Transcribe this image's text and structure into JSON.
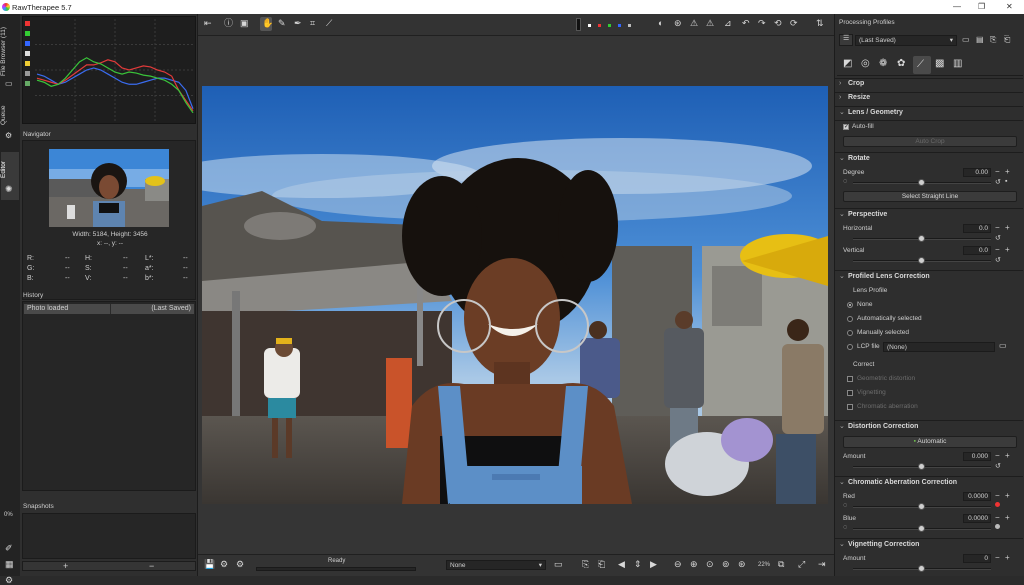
{
  "app": {
    "title": "RawTherapee 5.7"
  },
  "window_controls": {
    "minimize": "—",
    "maximize": "❐",
    "close": "✕"
  },
  "vtabs": {
    "file_browser": "File Browser (11)",
    "queue": "Queue",
    "editor": "Editor"
  },
  "navigator": {
    "header": "Navigator",
    "size_text": "Width: 5184, Height: 3456",
    "coords": "x: --, y: --",
    "readouts": [
      {
        "l1": "R:",
        "v1": "--",
        "l2": "H:",
        "v2": "--",
        "l3": "L*:",
        "v3": "--"
      },
      {
        "l1": "G:",
        "v1": "--",
        "l2": "S:",
        "v2": "--",
        "l3": "a*:",
        "v3": "--"
      },
      {
        "l1": "B:",
        "v1": "--",
        "l2": "V:",
        "v2": "--",
        "l3": "b*:",
        "v3": "--"
      }
    ]
  },
  "history": {
    "header": "History",
    "entry_name": "Photo loaded",
    "entry_value": "(Last Saved)"
  },
  "snapshots": {
    "header": "Snapshots",
    "add": "+",
    "remove": "−"
  },
  "left_strip": {
    "zoom_pct": "0%"
  },
  "status": {
    "ready": "Ready",
    "zoom": "22%",
    "profile_combo": "None"
  },
  "right": {
    "header": "Processing Profiles",
    "profile": "(Last Saved)",
    "sections": {
      "crop": "Crop",
      "resize": "Resize",
      "lens": "Lens / Geometry",
      "rotate": "Rotate",
      "perspective": "Perspective",
      "profiled": "Profiled Lens Correction",
      "distortion": "Distortion Correction",
      "ca": "Chromatic Aberration Correction",
      "vignetting": "Vignetting Correction"
    },
    "auto_fill": "Auto-fill",
    "auto_crop": "Auto Crop",
    "degree": {
      "label": "Degree",
      "value": "0.00"
    },
    "select_line": "Select Straight Line",
    "horizontal": {
      "label": "Horizontal",
      "value": "0.0"
    },
    "vertical": {
      "label": "Vertical",
      "value": "0.0"
    },
    "lens_profile": "Lens Profile",
    "lp_options": [
      "None",
      "Automatically selected",
      "Manually selected",
      "LCP file"
    ],
    "lcp_value": "(None)",
    "correct": "Correct",
    "correct_opts": [
      "Geometric distortion",
      "Vignetting",
      "Chromatic aberration"
    ],
    "automatic": "Automatic",
    "amount1": {
      "label": "Amount",
      "value": "0.000"
    },
    "red": {
      "label": "Red",
      "value": "0.0000"
    },
    "blue": {
      "label": "Blue",
      "value": "0.0000"
    },
    "amount2": {
      "label": "Amount",
      "value": "0"
    }
  },
  "histogram": {
    "red": [
      0.42,
      0.4,
      0.38,
      0.36,
      0.4,
      0.45,
      0.5,
      0.55,
      0.55,
      0.57,
      0.6,
      0.58,
      0.52,
      0.5,
      0.52,
      0.54,
      0.53,
      0.5,
      0.48,
      0.44,
      0.3,
      0.2,
      0.1
    ],
    "green": [
      0.4,
      0.38,
      0.34,
      0.36,
      0.42,
      0.5,
      0.58,
      0.62,
      0.58,
      0.56,
      0.52,
      0.48,
      0.46,
      0.48,
      0.47,
      0.45,
      0.44,
      0.42,
      0.4,
      0.36,
      0.3,
      0.18,
      0.08
    ],
    "blue": [
      0.46,
      0.44,
      0.4,
      0.36,
      0.38,
      0.42,
      0.46,
      0.5,
      0.52,
      0.5,
      0.46,
      0.42,
      0.38,
      0.36,
      0.36,
      0.38,
      0.4,
      0.42,
      0.42,
      0.4,
      0.38,
      0.3,
      0.12
    ]
  }
}
